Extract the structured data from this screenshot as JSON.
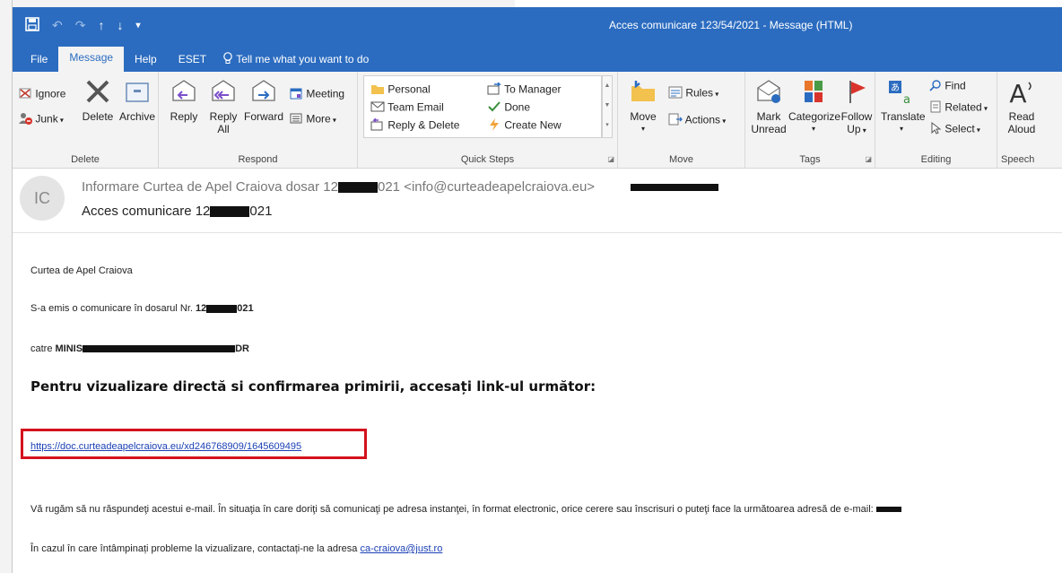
{
  "window": {
    "title": "Acces comunicare 123/54/2021 - Message (HTML)"
  },
  "tabs": [
    {
      "label": "File",
      "active": false
    },
    {
      "label": "Message",
      "active": true
    },
    {
      "label": "Help",
      "active": false
    },
    {
      "label": "ESET",
      "active": false
    },
    {
      "label": "Tell me what you want to do",
      "active": false
    }
  ],
  "ribbon": {
    "delete": {
      "label": "Delete",
      "ignore": "Ignore",
      "junk": "Junk",
      "delete_btn": "Delete",
      "archive": "Archive"
    },
    "respond": {
      "label": "Respond",
      "reply": "Reply",
      "reply_all_1": "Reply",
      "reply_all_2": "All",
      "forward": "Forward",
      "meeting": "Meeting",
      "more": "More"
    },
    "quick_steps": {
      "label": "Quick Steps",
      "items": [
        "Personal",
        "Team Email",
        "Reply & Delete",
        "To Manager",
        "Done",
        "Create New"
      ]
    },
    "move": {
      "label": "Move",
      "move_btn": "Move",
      "rules": "Rules",
      "actions": "Actions"
    },
    "tags": {
      "label": "Tags",
      "mark_unread_1": "Mark",
      "mark_unread_2": "Unread",
      "categorize": "Categorize",
      "follow_up_1": "Follow",
      "follow_up_2": "Up"
    },
    "editing": {
      "label": "Editing",
      "translate": "Translate",
      "find": "Find",
      "related": "Related",
      "select": "Select"
    },
    "speech": {
      "label": "Speech",
      "read_aloud_1": "Read",
      "read_aloud_2": "Aloud"
    }
  },
  "message": {
    "avatar_initials": "IC",
    "sender_prefix": "Informare Curtea de Apel Craiova dosar 12",
    "sender_suffix": "021 <info@curteadeapelcraiova.eu>",
    "subject_prefix": "Acces comunicare 12",
    "subject_suffix": "021",
    "body": {
      "greeting": "Curtea de Apel Craiova",
      "emis_prefix": "S-a emis o comunicare în dosarul Nr. ",
      "emis_bold_a": "12",
      "emis_bold_b": "021",
      "catre_prefix": "catre ",
      "catre_bold_a": "MINIS",
      "catre_bold_b": "DR",
      "heading": "Pentru vizualizare directă si confirmarea primirii, accesați link-ul următor:",
      "link": "https://doc.curteadeapelcraiova.eu/xd246768909/1645609495",
      "notice": "Vă rugăm să nu răspundeţi acestui  e-mail. În situaţia în care doriţi să comunicaţi pe adresa instanţei,  în format electronic, orice cerere sau înscrisuri o puteţi face la următoarea adresă de e-mail:",
      "contact_prefix": "În cazul în care întâmpinați probleme la vizualizare, contactați-ne la adresa ",
      "contact_email": "ca-craiova@just.ro"
    }
  },
  "colors": {
    "titlebar": "#2b6cc0",
    "ribbon_bg": "#f3f3f3",
    "highlight_border": "#d4121d",
    "link": "#1a3fb5"
  }
}
